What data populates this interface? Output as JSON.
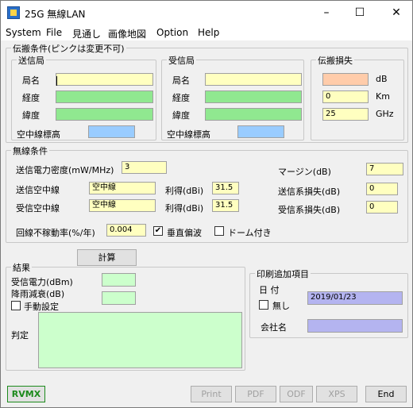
{
  "window": {
    "title": "25G 無線LAN",
    "minimize": "–",
    "maximize": "☐",
    "close": "✕"
  },
  "menu": [
    "System",
    "File",
    "見通し",
    "画像地図",
    "Option",
    "Help"
  ],
  "propagation": {
    "group_title": "伝搬条件(ピンクは変更不可)",
    "tx": {
      "title": "送信局",
      "name_label": "局名",
      "name": "",
      "lon_label": "経度",
      "lon": "",
      "lat_label": "緯度",
      "lat": "",
      "height_label": "空中線標高",
      "height": ""
    },
    "rx": {
      "title": "受信局",
      "name_label": "局名",
      "name": "",
      "lon_label": "経度",
      "lon": "",
      "lat_label": "緯度",
      "lat": "",
      "height_label": "空中線標高",
      "height": ""
    },
    "loss": {
      "title": "伝搬損失",
      "db_value": "",
      "db_unit": "dB",
      "km_value": "0",
      "km_unit": "Km",
      "ghz_value": "25",
      "ghz_unit": "GHz"
    }
  },
  "radio": {
    "group_title": "無線条件",
    "tx_power_label": "送信電力密度(mW/MHz)",
    "tx_power": "3",
    "tx_antenna_label": "送信空中線",
    "tx_antenna": "空中線",
    "tx_gain_label": "利得(dBi)",
    "tx_gain": "31.5",
    "rx_antenna_label": "受信空中線",
    "rx_antenna": "空中線",
    "rx_gain_label": "利得(dBi)",
    "rx_gain": "31.5",
    "margin_label": "マージン(dB)",
    "margin": "7",
    "tx_loss_label": "送信系損失(dB)",
    "tx_loss": "0",
    "rx_loss_label": "受信系損失(dB)",
    "rx_loss": "0",
    "outage_label": "回線不稼動率(%/年)",
    "outage": "0.004",
    "vertical_label": "垂直偏波",
    "vertical_checked": "✔",
    "dome_label": "ドーム付き",
    "dome_checked": ""
  },
  "calc_button": "計算",
  "result": {
    "group_title": "結果",
    "rx_power_label": "受信電力(dBm)",
    "rx_power": "",
    "rain_label": "降雨減衰(dB)",
    "rain": "",
    "manual_label": "手動設定",
    "manual_checked": "",
    "judge_label": "判定",
    "judge": ""
  },
  "print": {
    "group_title": "印刷追加項目",
    "date_label": "日 付",
    "none_label": "無し",
    "none_checked": "",
    "date": "2019/01/23",
    "company_label": "会社名",
    "company": ""
  },
  "bottom": {
    "logo": "RVMX",
    "print": "Print",
    "pdf": "PDF",
    "odf": "ODF",
    "xps": "XPS",
    "end": "End"
  }
}
